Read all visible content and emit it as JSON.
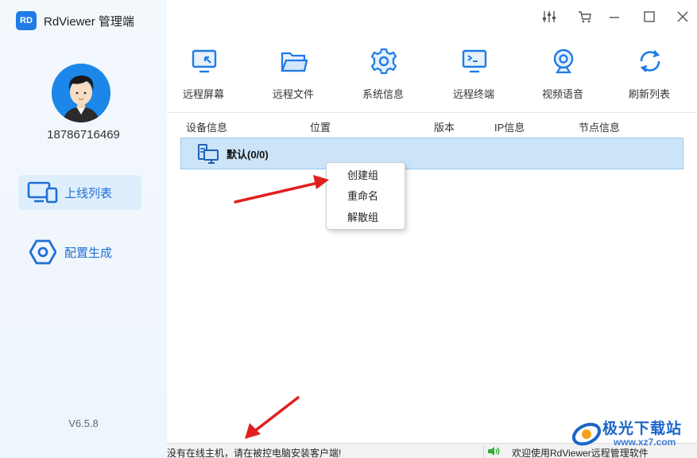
{
  "app": {
    "logo_text": "RD",
    "title": "RdViewer  管理端",
    "version": "V6.5.8"
  },
  "user": {
    "phone": "18786716469"
  },
  "sidebar": {
    "items": [
      {
        "label": "上线列表",
        "icon": "devices-icon",
        "active": true
      },
      {
        "label": "配置生成",
        "icon": "hexagon-gear-icon",
        "active": false
      }
    ]
  },
  "window_controls": [
    "settings-sliders-icon",
    "cart-icon",
    "minimize-icon",
    "maximize-icon",
    "close-icon"
  ],
  "toolbar": {
    "items": [
      {
        "label": "远程屏幕",
        "icon": "remote-screen-icon"
      },
      {
        "label": "远程文件",
        "icon": "folder-icon"
      },
      {
        "label": "系统信息",
        "icon": "gear-icon"
      },
      {
        "label": "远程终端",
        "icon": "terminal-icon"
      },
      {
        "label": "视频语音",
        "icon": "webcam-icon"
      },
      {
        "label": "刷新列表",
        "icon": "refresh-icon"
      }
    ]
  },
  "table": {
    "columns": [
      "设备信息",
      "位置",
      "版本",
      "IP信息",
      "节点信息"
    ],
    "groups": [
      {
        "label": "默认(0/0)"
      }
    ]
  },
  "context_menu": {
    "items": [
      "创建组",
      "重命名",
      "解散组"
    ]
  },
  "statusbar": {
    "left": "没有在线主机，请在被控电脑安装客户端!",
    "right": "欢迎使用RdViewer远程管理软件"
  },
  "watermark": {
    "text": "极光下载站",
    "url": "www.xz7.com"
  },
  "colors": {
    "accent": "#1f7be6",
    "selected_row": "#cce4f7",
    "arrow": "#e02020"
  }
}
